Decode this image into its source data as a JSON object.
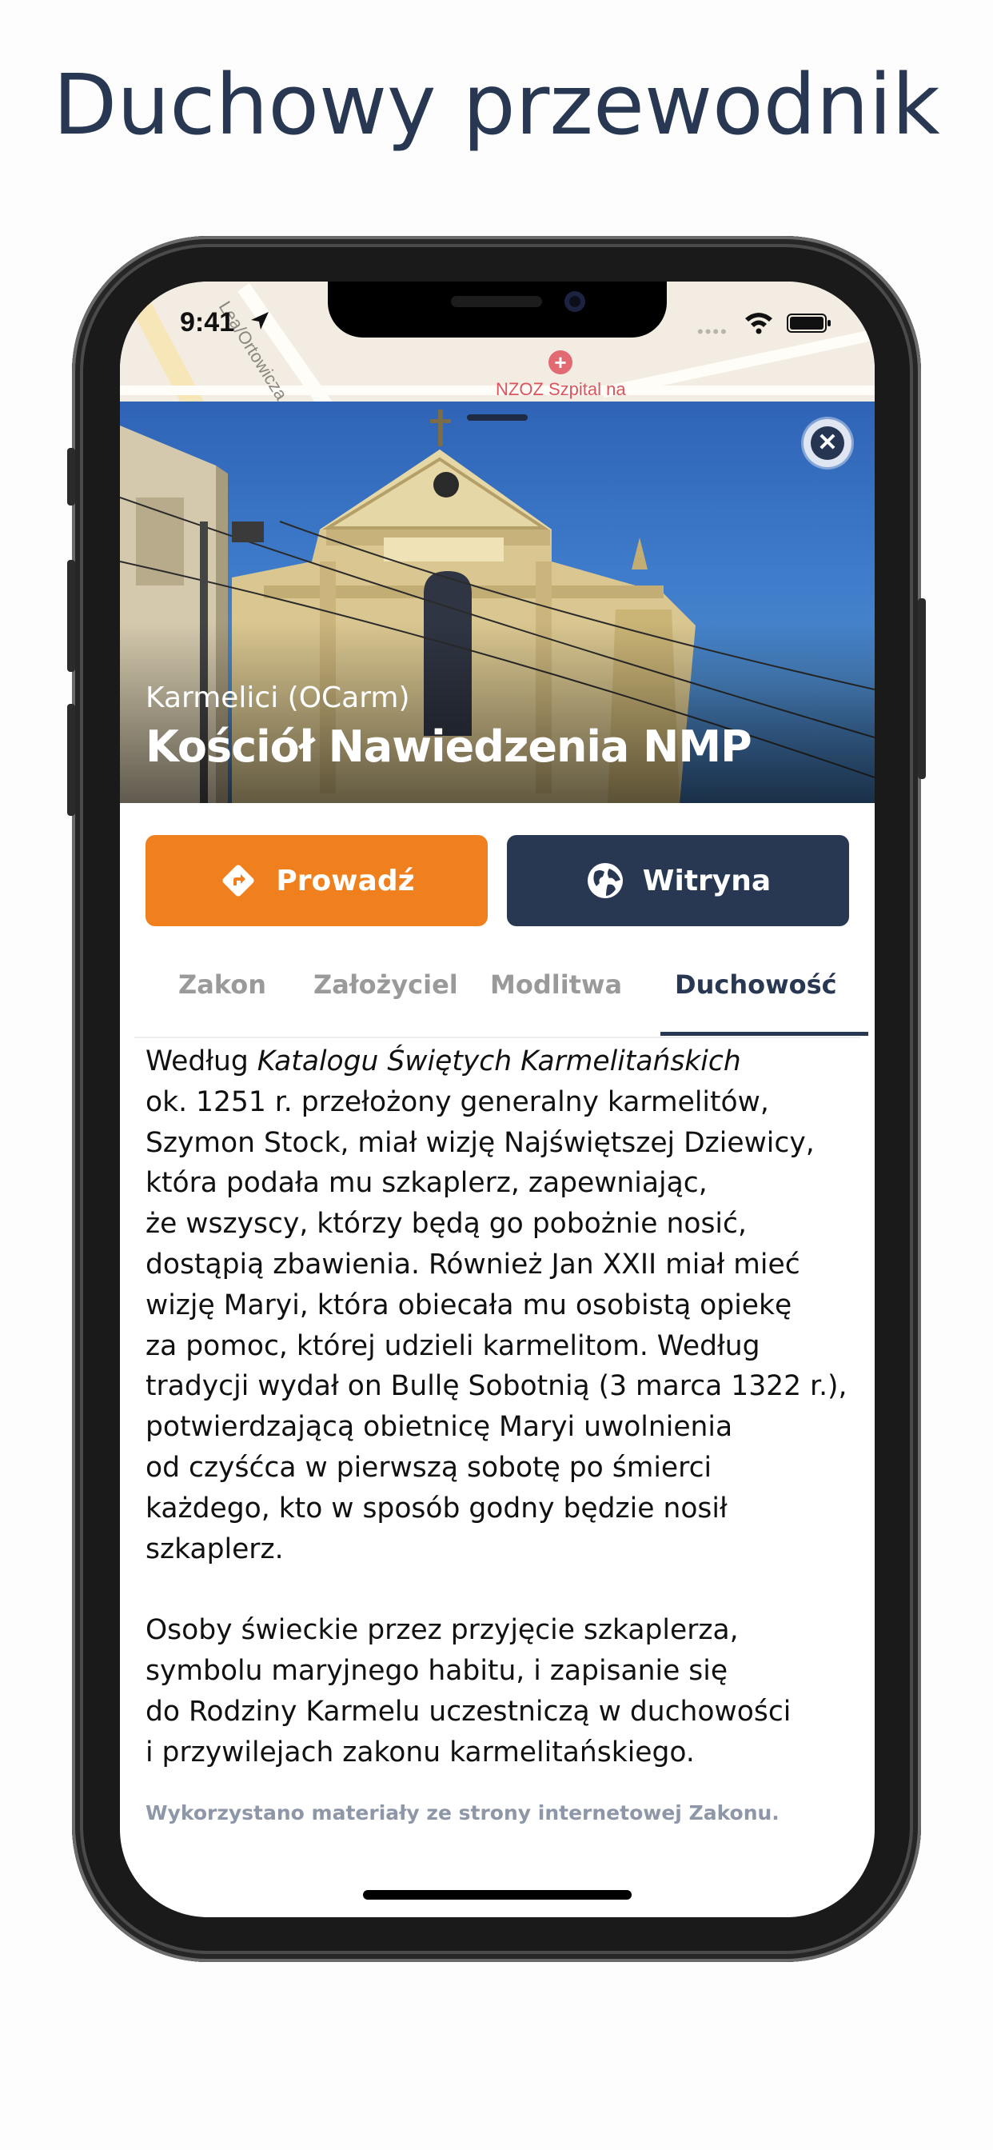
{
  "promo": {
    "title": "Duchowy przewodnik"
  },
  "status_bar": {
    "time": "9:41",
    "dots": "••••"
  },
  "map": {
    "street": "Lea/Ortowicza",
    "poi": "NZOZ Szpital na"
  },
  "hero": {
    "subtitle": "Karmelici (OCarm)",
    "title": "Kościół Nawiedzenia NMP",
    "close_glyph": "✕"
  },
  "actions": {
    "guide_label": "Prowadź",
    "website_label": "Witryna"
  },
  "tabs": [
    {
      "label": "Zakon"
    },
    {
      "label": "Założyciel"
    },
    {
      "label": "Modlitwa"
    },
    {
      "label": "Duchowość",
      "active": true
    }
  ],
  "content": {
    "p1_prefix": "Według ",
    "p1_italic": "Katalogu Świętych Karmelitańskich",
    "p1_lines": [
      "ok. 1251 r. przełożony generalny karmelitów,",
      "Szymon Stock, miał wizję Najświętszej Dziewicy,",
      "która podała mu szkaplerz, zapewniając,",
      "że wszyscy, którzy będą go pobożnie nosić,",
      "dostąpią zbawienia. Również Jan XXII miał mieć",
      "wizję Maryi, która obiecała mu osobistą opiekę",
      "za pomoc, której udzieli karmelitom. Według",
      "tradycji wydał on Bullę Sobotnią (3 marca 1322 r.),",
      "potwierdzającą obietnicę Maryi uwolnienia",
      "od czyśćca w pierwszą sobotę po śmierci",
      "każdego, kto w sposób godny będzie nosił",
      "szkaplerz."
    ],
    "p2_lines": [
      "Osoby świeckie przez przyjęcie szkaplerza,",
      "symbolu maryjnego habitu, i zapisanie się",
      "do Rodziny Karmelu uczestniczą w duchowości",
      "i przywilejach zakonu karmelitańskiego."
    ],
    "source_note": "Wykorzystano materiały ze strony internetowej Zakonu."
  },
  "colors": {
    "navy": "#283752",
    "orange": "#f0801e"
  }
}
